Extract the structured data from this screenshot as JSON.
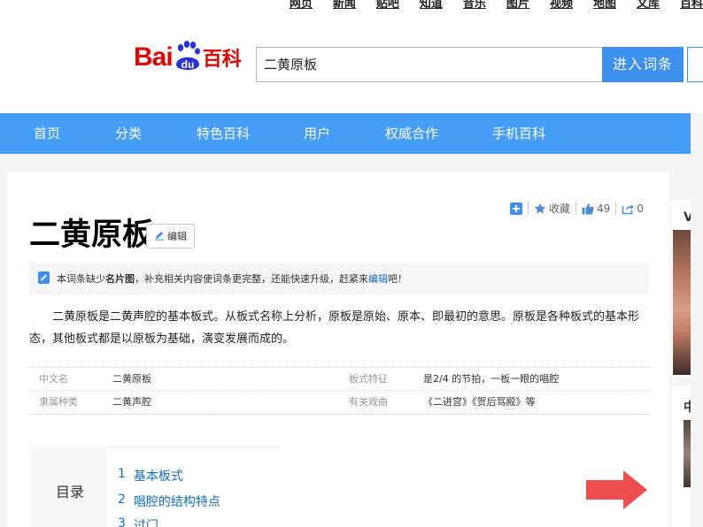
{
  "top_nav": [
    "网页",
    "新闻",
    "贴吧",
    "知道",
    "音乐",
    "图片",
    "视频",
    "地图",
    "文库",
    "百科"
  ],
  "logo": {
    "bai": "Bai",
    "du": "du",
    "baike": "百科"
  },
  "search": {
    "value": "二黄原板",
    "button_label": "进入词条"
  },
  "main_nav": [
    "首页",
    "分类",
    "特色百科",
    "用户",
    "权威合作",
    "手机百科"
  ],
  "actions": {
    "favorite_label": "收藏",
    "like_count": "49",
    "share_count": "0"
  },
  "entry": {
    "title": "二黄原板",
    "edit_label": "编辑",
    "notice": {
      "prefix": "本词条缺少",
      "strong": "名片图",
      "middle": "，补充相关内容使词条更完整，还能快速升级，赶紧来",
      "link": "编辑",
      "suffix": "吧！"
    },
    "summary": "二黄原板是二黄声腔的基本板式。从板式名称上分析，原板是原始、原本、即最初的意思。原板是各种板式的基本形态，其他板式都是以原板为基础，演变发展而成的。",
    "basic_info": [
      {
        "name1": "中文名",
        "value1": "二黄原板",
        "name2": "板式特征",
        "value2": "是2/4 的节拍，一板一眼的唱腔"
      },
      {
        "name1": "隶属种类",
        "value1": "二黄声腔",
        "name2": "有关戏曲",
        "value2": "《二进宫》《贺后骂殿》等"
      }
    ]
  },
  "toc": {
    "title": "目录",
    "items": [
      {
        "num": "1",
        "label": "基本板式"
      },
      {
        "num": "2",
        "label": "唱腔的结构特点"
      },
      {
        "num": "3",
        "label": "过门"
      }
    ]
  },
  "right_panel": {
    "letter1": "V",
    "letter2": "中"
  },
  "colors": {
    "brand_red": "#e10602",
    "brand_blue": "#2932e1",
    "nav_blue": "#459df5",
    "button_blue": "#3d8ff0",
    "link_blue": "#136ec2",
    "arrow_red": "#ee4d4d"
  }
}
